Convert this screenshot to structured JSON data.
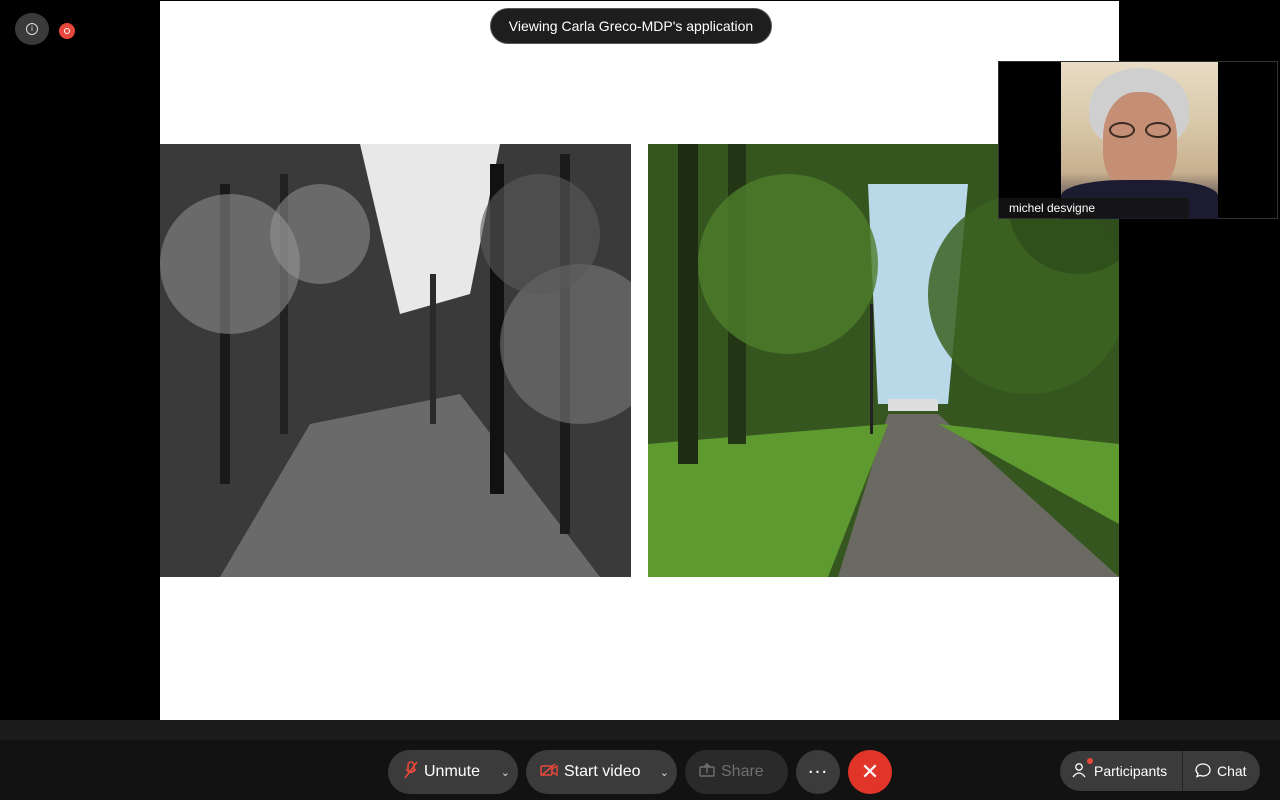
{
  "banner": {
    "text": "Viewing Carla Greco-MDP's application"
  },
  "video_tile": {
    "participant_name": "michel desvigne"
  },
  "toolbar": {
    "unmute_label": "Unmute",
    "start_video_label": "Start video",
    "share_label": "Share",
    "more_label": "···",
    "end_label": "✕",
    "participants_label": "Participants",
    "chat_label": "Chat"
  },
  "icons": {
    "info": "info-icon",
    "recording": "recording-icon",
    "mic_muted": "mic-muted-icon",
    "video_off": "video-off-icon",
    "share": "share-icon",
    "participants": "person-icon",
    "chat": "chat-bubble-icon"
  },
  "colors": {
    "end_call": "#e2352a",
    "recording": "#e8473b",
    "toolbar_button": "#3b3b3b"
  }
}
